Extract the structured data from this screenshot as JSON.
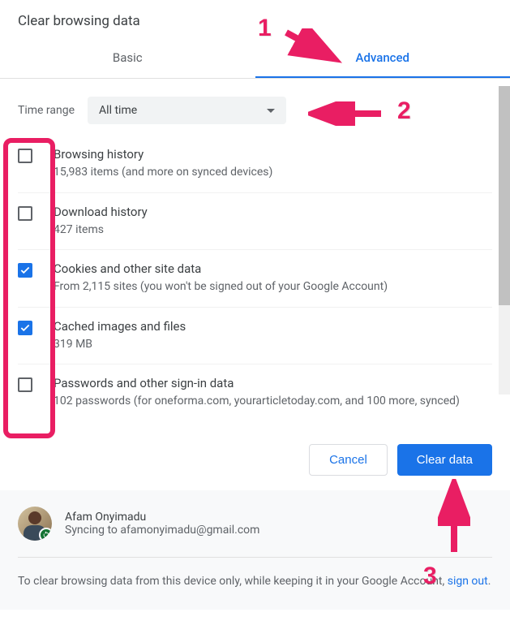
{
  "title": "Clear browsing data",
  "tabs": {
    "basic": "Basic",
    "advanced": "Advanced"
  },
  "timeRange": {
    "label": "Time range",
    "value": "All time"
  },
  "items": [
    {
      "checked": false,
      "title": "Browsing history",
      "sub": "15,983 items (and more on synced devices)"
    },
    {
      "checked": false,
      "title": "Download history",
      "sub": "427 items"
    },
    {
      "checked": true,
      "title": "Cookies and other site data",
      "sub": "From 2,115 sites (you won't be signed out of your Google Account)"
    },
    {
      "checked": true,
      "title": "Cached images and files",
      "sub": "319 MB"
    },
    {
      "checked": false,
      "title": "Passwords and other sign-in data",
      "sub": "102 passwords (for oneforma.com, yourarticletoday.com, and 100 more, synced)"
    }
  ],
  "buttons": {
    "cancel": "Cancel",
    "clear": "Clear data"
  },
  "account": {
    "name": "Afam Onyimadu",
    "status": "Syncing to afamonyimadu@gmail.com",
    "noteBefore": "To clear browsing data from this device only, while keeping it in your Google Account, ",
    "signout": "sign out",
    "noteAfter": "."
  },
  "annotations": {
    "one": "1",
    "two": "2",
    "three": "3"
  }
}
